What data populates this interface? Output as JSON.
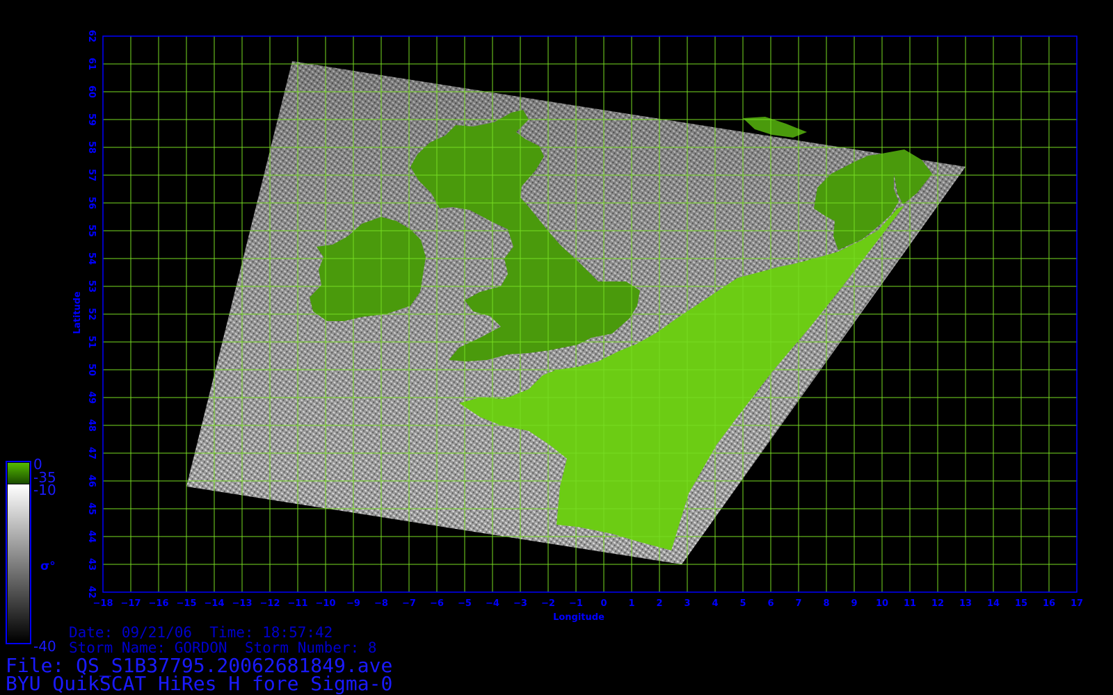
{
  "plot": {
    "xlabel": "Longitude",
    "ylabel": "Latitude",
    "lon_range": [
      -18,
      17
    ],
    "lat_range": [
      42,
      62
    ],
    "lon_ticks": [
      -18,
      -17,
      -16,
      -15,
      -14,
      -13,
      -12,
      -11,
      -10,
      -9,
      -8,
      -7,
      -6,
      -5,
      -4,
      -3,
      -2,
      -1,
      0,
      1,
      2,
      3,
      4,
      5,
      6,
      7,
      8,
      9,
      10,
      11,
      12,
      13,
      14,
      15,
      16,
      17
    ],
    "lat_ticks": [
      42,
      43,
      44,
      45,
      46,
      47,
      48,
      49,
      50,
      51,
      52,
      53,
      54,
      55,
      56,
      57,
      58,
      59,
      60,
      61,
      62
    ],
    "grid": true,
    "colors": {
      "axis": "#0000ff",
      "grid": "#77dd22",
      "land": "#4a9a0c",
      "land_light": "#6ccc14",
      "background": "#000000"
    }
  },
  "swath": {
    "corners_lonlat": [
      [
        -11.2,
        61.1
      ],
      [
        13.0,
        57.3
      ],
      [
        2.8,
        43.0
      ],
      [
        -15.0,
        45.8
      ]
    ]
  },
  "colorbar": {
    "land_labels": [
      "0",
      "-35"
    ],
    "sigma_labels": [
      "-10",
      "-40"
    ],
    "symbol": "σ°",
    "colors": {
      "land_top": "#55bb00",
      "land_bottom": "#1a4a00",
      "sigma_top": "#ffffff",
      "sigma_bottom": "#000000",
      "frame": "#0000ff"
    }
  },
  "info": {
    "date_time": "Date: 09/21/06  Time: 18:57:42",
    "storm": "Storm Name: GORDON  Storm Number: 8",
    "file": "File: QS_S1B37795.20062681849.ave",
    "title": "BYU QuikSCAT HiRes H fore Sigma-0"
  }
}
